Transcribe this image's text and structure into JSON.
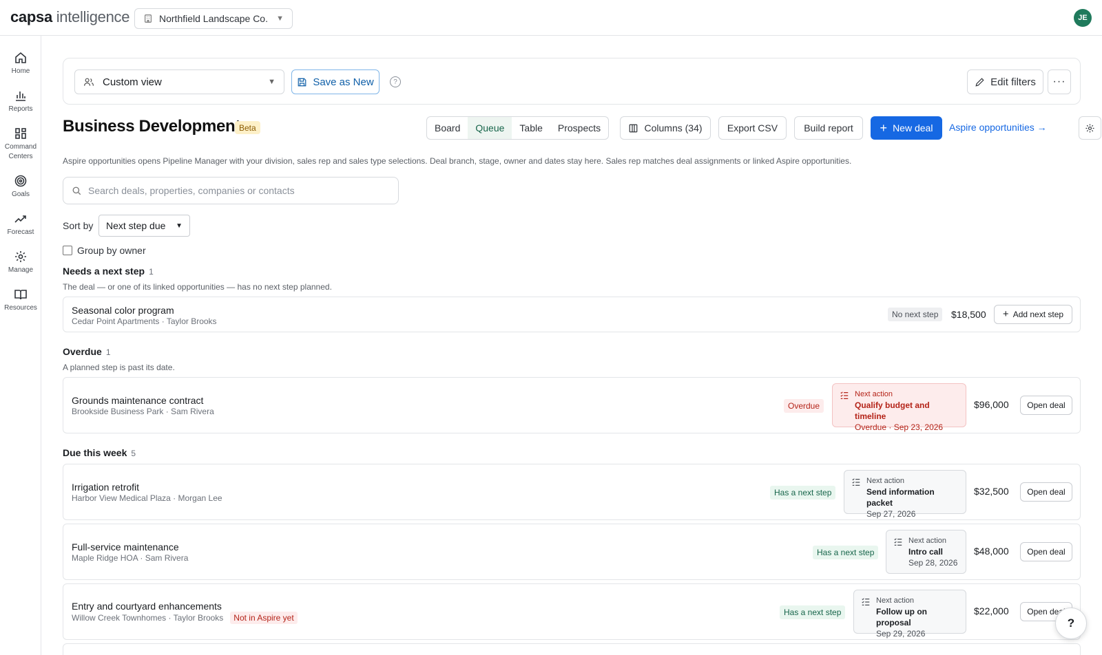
{
  "brand": {
    "bold": "capsa",
    "light": " intelligence"
  },
  "org_select": {
    "value": "Northfield Landscape Co."
  },
  "user": {
    "initials": "JE"
  },
  "sidebar": {
    "items": [
      {
        "label": "Home",
        "icon": "home-icon"
      },
      {
        "label": "Reports",
        "icon": "bar-chart-icon"
      },
      {
        "label": "Command Centers",
        "icon": "grid-icon"
      },
      {
        "label": "Goals",
        "icon": "target-icon"
      },
      {
        "label": "Forecast",
        "icon": "trend-icon"
      },
      {
        "label": "Manage",
        "icon": "gear-icon"
      },
      {
        "label": "Resources",
        "icon": "book-icon"
      }
    ]
  },
  "filterbar": {
    "view_value": "Custom view",
    "save_label": "Save as New",
    "help_glyph": "?",
    "edit_filters_label": "Edit filters",
    "more_glyph": "···"
  },
  "header": {
    "title": "Business Development",
    "badge": "Beta",
    "views": [
      "Board",
      "Queue",
      "Table",
      "Prospects"
    ],
    "active_view": "Queue",
    "columns_label": "Columns (34)",
    "export_label": "Export CSV",
    "build_report_label": "Build report",
    "new_deal_label": "New deal",
    "aspire_link": "Aspire opportunities →",
    "info": "Aspire opportunities opens Pipeline Manager with your division, sales rep and sales type selections. Deal branch, stage, owner and dates stay here. Sales rep matches deal assignments or linked Aspire opportunities."
  },
  "search": {
    "placeholder": "Search deals, properties, companies or contacts"
  },
  "sort": {
    "label": "Sort by",
    "value": "Next step due"
  },
  "group_by_owner": {
    "label": "Group by owner",
    "checked": false
  },
  "sections": {
    "needs": {
      "title": "Needs a next step",
      "count": "1",
      "desc": "The deal — or one of its linked opportunities — has no next step planned."
    },
    "overdue": {
      "title": "Overdue",
      "count": "1",
      "desc": "A planned step is past its date."
    },
    "week": {
      "title": "Due this week",
      "count": "5"
    }
  },
  "deals": {
    "d1": {
      "name": "Seasonal color program",
      "sub": "Cedar Point Apartments · Taylor Brooks",
      "status": "No next step",
      "amount": "$18,500",
      "button": "Add next step"
    },
    "d2": {
      "name": "Grounds maintenance contract",
      "sub": "Brookside Business Park · Sam Rivera",
      "status": "Overdue",
      "action_head": "Next action",
      "action_title": "Qualify budget and timeline",
      "action_date": "Overdue · Sep 23, 2026",
      "amount": "$96,000",
      "button": "Open deal"
    },
    "d3": {
      "name": "Irrigation retrofit",
      "sub": "Harbor View Medical Plaza · Morgan Lee",
      "status": "Has a next step",
      "action_head": "Next action",
      "action_title": "Send information packet",
      "action_date": "Sep 27, 2026",
      "amount": "$32,500",
      "button": "Open deal"
    },
    "d4": {
      "name": "Full-service maintenance",
      "sub": "Maple Ridge HOA · Sam Rivera",
      "status": "Has a next step",
      "action_head": "Next action",
      "action_title": "Intro call",
      "action_date": "Sep 28, 2026",
      "amount": "$48,000",
      "button": "Open deal"
    },
    "d5": {
      "name": "Entry and courtyard enhancements",
      "sub": "Willow Creek Townhomes · Taylor Brooks",
      "tag": "Not in Aspire yet",
      "status": "Has a next step",
      "action_head": "Next action",
      "action_title": "Follow up on proposal",
      "action_date": "Sep 29, 2026",
      "amount": "$22,000",
      "button": "Open deal"
    }
  },
  "help_fab": "?",
  "colors": {
    "primary": "#1668e3",
    "accent_green": "#17654a",
    "danger": "#b42318",
    "avatar": "#1f7a5c"
  }
}
